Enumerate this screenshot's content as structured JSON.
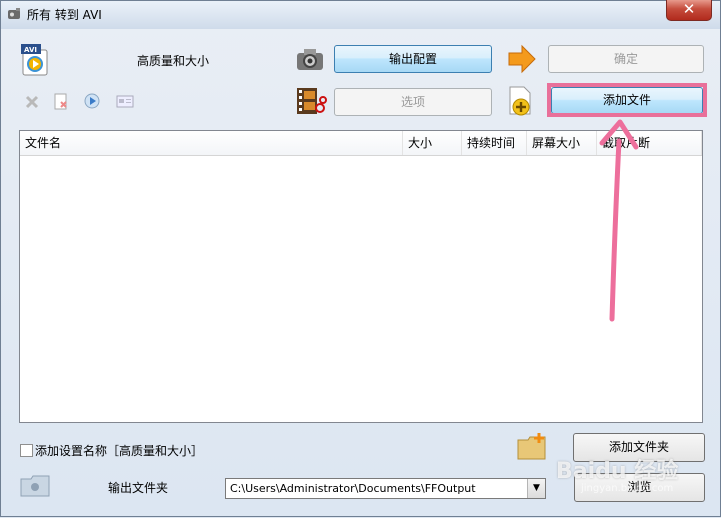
{
  "window": {
    "title": "所有 转到 AVI",
    "close_glyph": "✕"
  },
  "profile": {
    "name": "高质量和大小",
    "output_config_label": "输出配置",
    "ok_label": "确定",
    "options_label": "选项",
    "add_file_label": "添加文件"
  },
  "file_list": {
    "columns": [
      "文件名",
      "大小",
      "持续时间",
      "屏幕大小",
      "截取片断"
    ],
    "rows": []
  },
  "bottom": {
    "add_setting_name_label": "添加设置名称［高质量和大小］",
    "add_folder_label": "添加文件夹",
    "output_folder_label": "输出文件夹",
    "output_path": "C:\\Users\\Administrator\\Documents\\FFOutput",
    "browse_label": "浏览"
  },
  "watermark": {
    "text": "Baidu 经验",
    "sub": "jingyan.baidu.com"
  },
  "colors": {
    "highlight": "#e9709a"
  },
  "icons": [
    "app-icon",
    "avi-format-icon",
    "delete-icon",
    "remove-icon",
    "play-icon",
    "info-icon",
    "camera-icon",
    "film-edit-icon",
    "arrow-right-icon",
    "add-file-icon",
    "folder-icon",
    "add-folder-icon"
  ]
}
